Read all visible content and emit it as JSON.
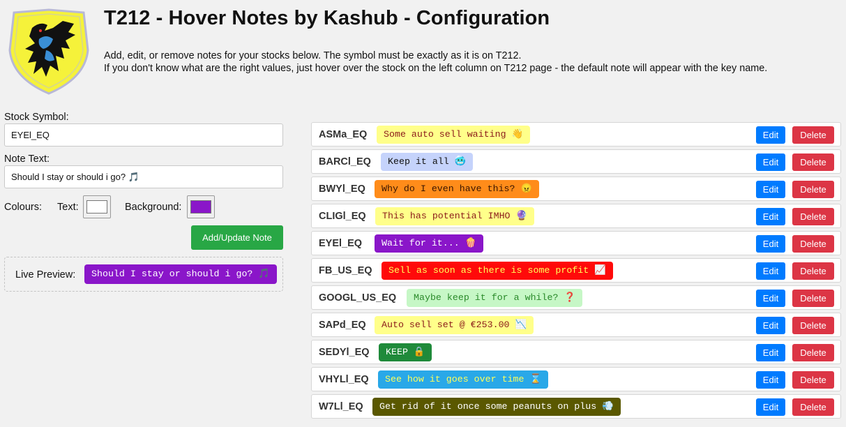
{
  "header": {
    "title": "T212 - Hover Notes by Kashub - Configuration",
    "desc_line1": "Add, edit, or remove notes for your stocks below. The symbol must be exactly as it is on T212.",
    "desc_line2": "If you don't know what are the right values, just hover over the stock on the left column on T212 page - the default note will appear with the key name."
  },
  "form": {
    "symbol_label": "Stock Symbol:",
    "symbol_value": "EYEl_EQ",
    "note_label": "Note Text:",
    "note_value": "Should I stay or should i go? 🎵",
    "colours_label": "Colours:",
    "text_label": "Text:",
    "text_color": "#ffffff",
    "background_label": "Background:",
    "background_color": "#8a16c9",
    "add_button": "Add/Update Note"
  },
  "preview": {
    "label": "Live Preview:",
    "text": "Should I stay or should i go? 🎵"
  },
  "buttons": {
    "edit": "Edit",
    "delete": "Delete"
  },
  "notes": [
    {
      "symbol": "ASMa_EQ",
      "note": "Some auto sell waiting 👋",
      "text_color": "#8b1a1a",
      "bg_color": "#ffff8a"
    },
    {
      "symbol": "BARCl_EQ",
      "note": "Keep it all 🥶",
      "text_color": "#111111",
      "bg_color": "#c5d3fb"
    },
    {
      "symbol": "BWYl_EQ",
      "note": "Why do I even have this? 😠",
      "text_color": "#3a1500",
      "bg_color": "#ff8c1a"
    },
    {
      "symbol": "CLIGl_EQ",
      "note": "This has potential IMHO 🔮",
      "text_color": "#8b1a1a",
      "bg_color": "#ffff8a"
    },
    {
      "symbol": "EYEl_EQ",
      "note": "Wait for it... 🍿",
      "text_color": "#ffffff",
      "bg_color": "#8a16c9"
    },
    {
      "symbol": "FB_US_EQ",
      "note": "Sell as soon as there is some profit 📈",
      "text_color": "#ffff5a",
      "bg_color": "#ff0a0a"
    },
    {
      "symbol": "GOOGL_US_EQ",
      "note": "Maybe keep it for a while? ❓",
      "text_color": "#2a8a2a",
      "bg_color": "#c6f7c6"
    },
    {
      "symbol": "SAPd_EQ",
      "note": "Auto sell set @ €253.00 📉",
      "text_color": "#8b1a1a",
      "bg_color": "#ffff8a"
    },
    {
      "symbol": "SEDYl_EQ",
      "note": "KEEP 🔒",
      "text_color": "#ffffff",
      "bg_color": "#1f8a3a"
    },
    {
      "symbol": "VHYLl_EQ",
      "note": "See how it goes over time ⌛",
      "text_color": "#ffff5a",
      "bg_color": "#29a8e8"
    },
    {
      "symbol": "W7Ll_EQ",
      "note": "Get rid of it once some peanuts on plus 💨",
      "text_color": "#ffffff",
      "bg_color": "#5a5800"
    }
  ]
}
